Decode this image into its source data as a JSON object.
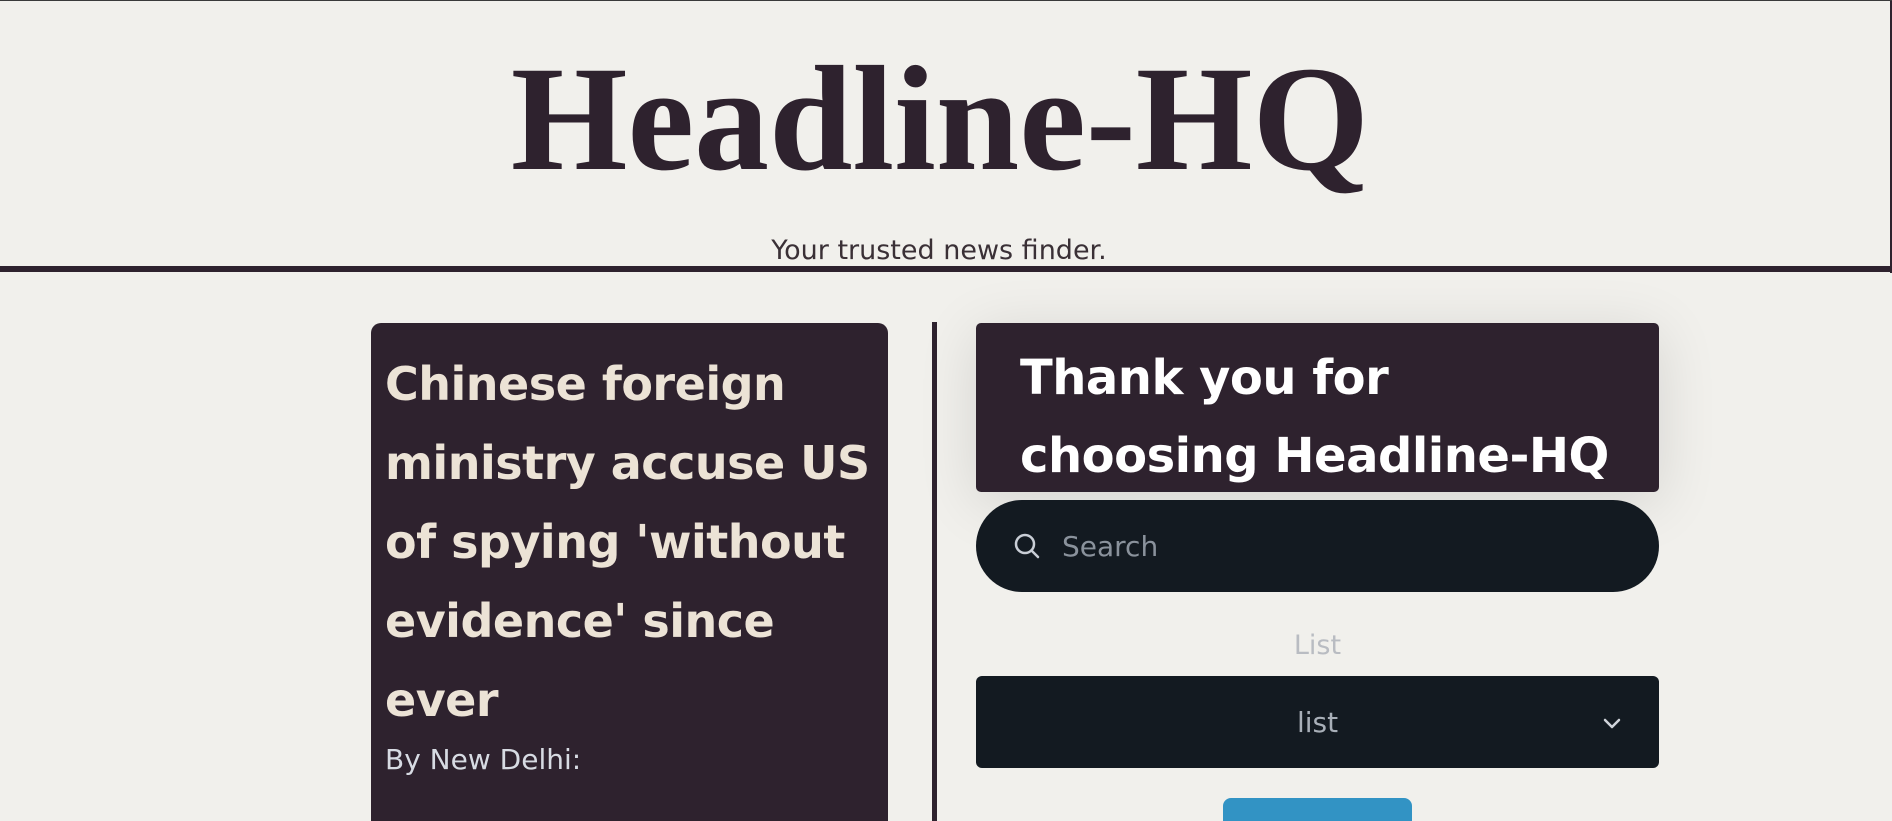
{
  "header": {
    "title": "Headline-HQ",
    "tagline": "Your trusted news finder."
  },
  "article": {
    "title": "Chinese foreign ministry accuse US of spying 'without evidence' since ever",
    "byline": "By New Delhi:"
  },
  "sidebar": {
    "welcome": "Thank you for choosing Headline-HQ",
    "search": {
      "placeholder": "Search",
      "icon": "search-icon"
    },
    "list_label": "List",
    "list_select": {
      "value": "list",
      "icon": "chevron-down-icon"
    },
    "submit_button": {
      "label": ""
    }
  },
  "colors": {
    "background": "#f1f0ec",
    "brand_dark": "#2e222e",
    "card_text": "#ece3d6",
    "input_bg": "#131a21",
    "button_accent": "#3293c4"
  }
}
